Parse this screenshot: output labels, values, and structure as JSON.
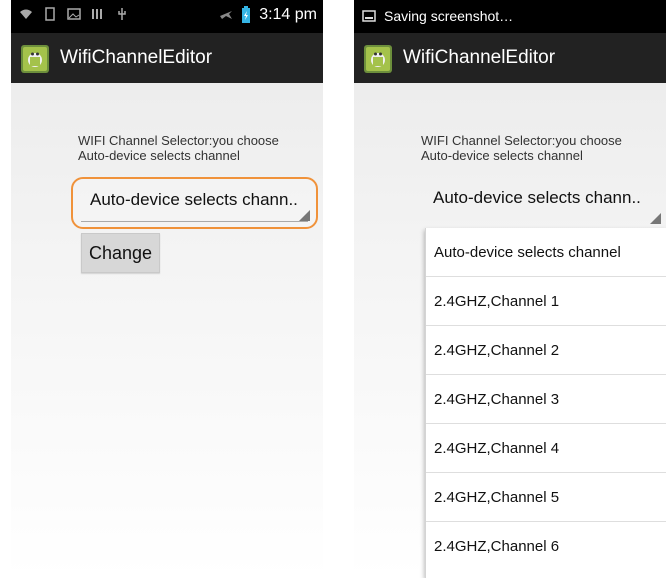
{
  "app": {
    "title": "WifiChannelEditor",
    "icon": "android-app-icon"
  },
  "left_screen": {
    "status_bar": {
      "time": "3:14 pm"
    },
    "description_line1": "WIFI Channel Selector:you choose",
    "description_line2": "Auto-device selects channel",
    "spinner_value": "Auto-device selects chann..",
    "change_button": "Change"
  },
  "right_screen": {
    "status_bar": {
      "notification": "Saving screenshot…"
    },
    "description_line1": "WIFI Channel Selector:you choose",
    "description_line2": "Auto-device selects channel",
    "spinner_value": "Auto-device selects chann..",
    "dropdown_options": [
      "Auto-device selects channel",
      "2.4GHZ,Channel 1",
      "2.4GHZ,Channel 2",
      "2.4GHZ,Channel 3",
      "2.4GHZ,Channel 4",
      "2.4GHZ,Channel 5",
      "2.4GHZ,Channel 6"
    ]
  },
  "colors": {
    "accent": "#f0923a",
    "status_bar": "#000000",
    "action_bar": "#222222"
  }
}
